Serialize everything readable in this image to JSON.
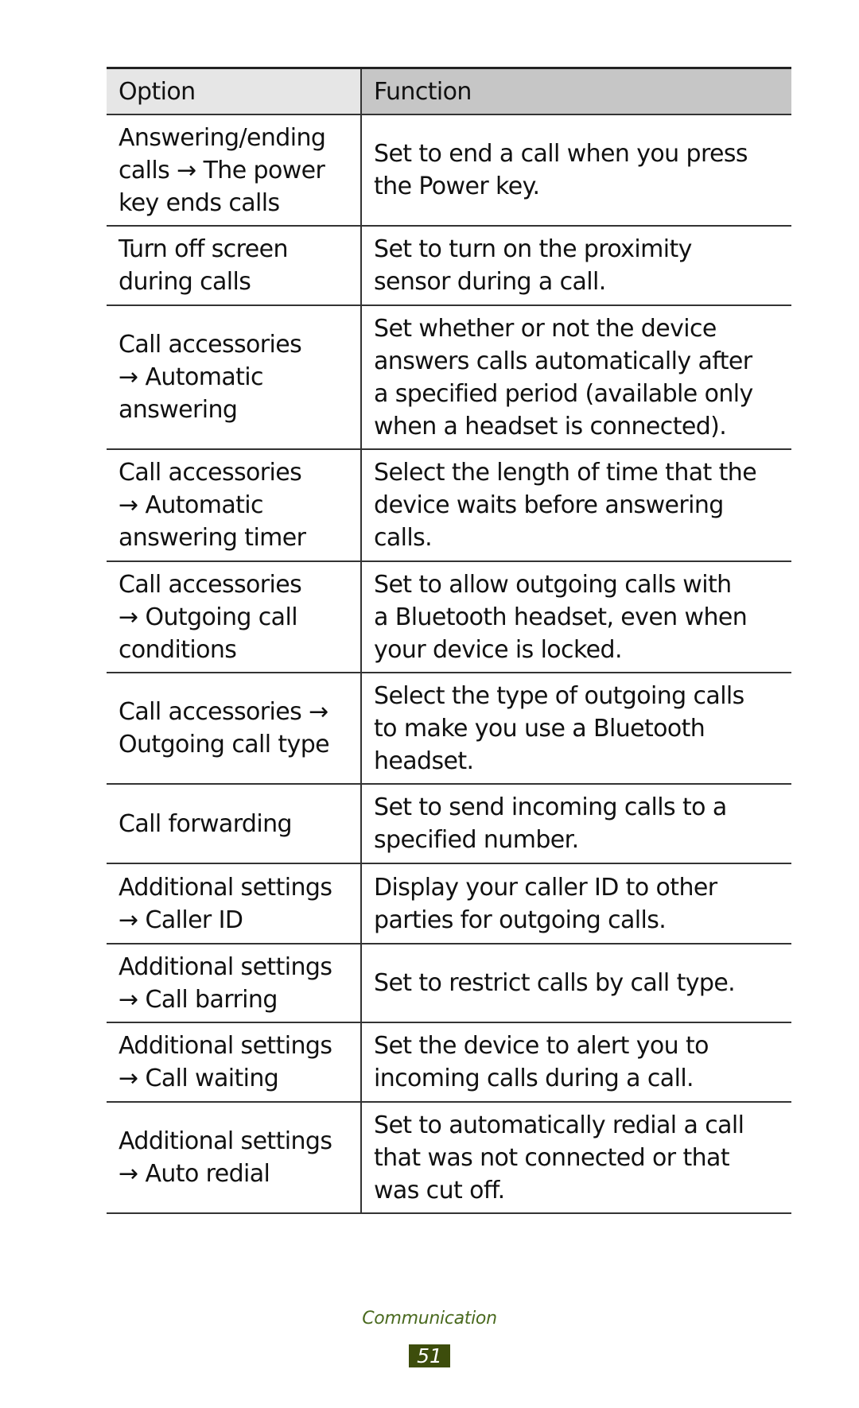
{
  "table": {
    "headers": {
      "option": "Option",
      "function": "Function"
    },
    "rows": [
      {
        "option": [
          "Answering/ending",
          "calls → The power",
          "key ends calls"
        ],
        "function": [
          "Set to end a call when you press",
          "the Power key."
        ]
      },
      {
        "option": [
          "Turn off screen",
          "during calls"
        ],
        "function": [
          "Set to turn on the proximity",
          "sensor during a call."
        ]
      },
      {
        "option": [
          "Call accessories",
          "→ Automatic",
          "answering"
        ],
        "function": [
          "Set whether or not the device",
          "answers calls automatically after",
          "a specified period (available only",
          "when a headset is connected)."
        ]
      },
      {
        "option": [
          "Call accessories",
          "→ Automatic",
          "answering timer"
        ],
        "function": [
          "Select the length of time that the",
          "device waits before answering",
          "calls."
        ]
      },
      {
        "option": [
          "Call accessories",
          "→ Outgoing call",
          "conditions"
        ],
        "function": [
          "Set to allow outgoing calls with",
          "a Bluetooth headset, even when",
          "your device is locked."
        ]
      },
      {
        "option": [
          "Call accessories →",
          "Outgoing call type"
        ],
        "function": [
          "Select the type of outgoing calls",
          "to make you use a Bluetooth",
          "headset."
        ]
      },
      {
        "option": [
          "Call forwarding"
        ],
        "function": [
          "Set to send incoming calls to a",
          "specified number."
        ]
      },
      {
        "option": [
          "Additional settings",
          "→ Caller ID"
        ],
        "function": [
          "Display your caller ID to other",
          "parties for outgoing calls."
        ]
      },
      {
        "option": [
          "Additional settings",
          "→ Call barring"
        ],
        "function": [
          "Set to restrict calls by call type."
        ]
      },
      {
        "option": [
          "Additional settings",
          "→ Call waiting"
        ],
        "function": [
          "Set the device to alert you to",
          "incoming calls during a call."
        ]
      },
      {
        "option": [
          "Additional settings",
          "→ Auto redial"
        ],
        "function": [
          "Set to automatically redial a call",
          "that was not connected or that",
          "was cut off."
        ]
      }
    ]
  },
  "footer": {
    "section": "Communication",
    "page_number": "51"
  },
  "colors": {
    "header_option_bg": "#e6e6e6",
    "header_function_bg": "#c6c6c6",
    "footer_text": "#4a6a1f",
    "page_badge_bg": "#3d4d0c"
  }
}
